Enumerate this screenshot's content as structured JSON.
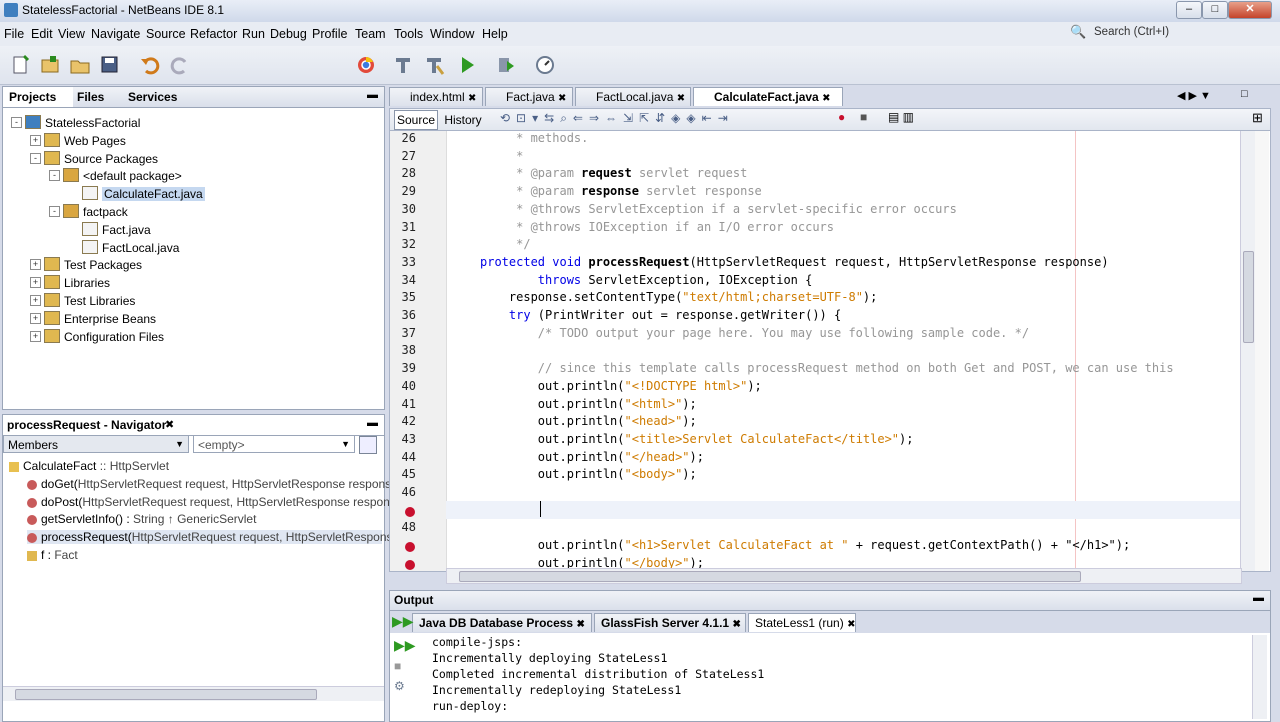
{
  "window": {
    "title": "StatelessFactorial - NetBeans IDE 8.1"
  },
  "menu": [
    "File",
    "Edit",
    "View",
    "Navigate",
    "Source",
    "Refactor",
    "Run",
    "Debug",
    "Profile",
    "Team",
    "Tools",
    "Window",
    "Help"
  ],
  "search": {
    "placeholder": "Search (Ctrl+I)"
  },
  "projects_panel": {
    "tabs": [
      "Projects",
      "Files",
      "Services"
    ],
    "tree": [
      {
        "label": "StatelessFactorial",
        "level": 0,
        "expander": "-",
        "icon": "globe-icon"
      },
      {
        "label": "Web Pages",
        "level": 1,
        "expander": "+",
        "icon": "folder-icon"
      },
      {
        "label": "Source Packages",
        "level": 1,
        "expander": "-",
        "icon": "folder-icon"
      },
      {
        "label": "<default package>",
        "level": 2,
        "expander": "-",
        "icon": "package-icon"
      },
      {
        "label": "CalculateFact.java",
        "level": 3,
        "expander": "",
        "icon": "java-file-icon",
        "selected": true
      },
      {
        "label": "factpack",
        "level": 2,
        "expander": "-",
        "icon": "package-icon"
      },
      {
        "label": "Fact.java",
        "level": 3,
        "expander": "",
        "icon": "java-file-icon"
      },
      {
        "label": "FactLocal.java",
        "level": 3,
        "expander": "",
        "icon": "java-file-icon"
      },
      {
        "label": "Test Packages",
        "level": 1,
        "expander": "+",
        "icon": "folder-icon"
      },
      {
        "label": "Libraries",
        "level": 1,
        "expander": "+",
        "icon": "folder-icon"
      },
      {
        "label": "Test Libraries",
        "level": 1,
        "expander": "+",
        "icon": "folder-icon"
      },
      {
        "label": "Enterprise Beans",
        "level": 1,
        "expander": "+",
        "icon": "folder-icon"
      },
      {
        "label": "Configuration Files",
        "level": 1,
        "expander": "+",
        "icon": "folder-icon"
      }
    ]
  },
  "navigator": {
    "title": "processRequest - Navigator",
    "members_label": "Members",
    "filter_value": "<empty>",
    "items": [
      {
        "name": "CalculateFact",
        "type": " :: HttpServlet"
      },
      {
        "name": "doGet(",
        "type": "HttpServletRequest request, HttpServletResponse response) ↑ H"
      },
      {
        "name": "doPost(",
        "type": "HttpServletRequest request, HttpServletResponse response) ↑"
      },
      {
        "name": "getServletInfo() : ",
        "type": "String ↑ GenericServlet"
      },
      {
        "name": "processRequest(",
        "type": "HttpServletRequest request, HttpServletResponse res"
      },
      {
        "name": "f : ",
        "type": "Fact"
      }
    ]
  },
  "editor": {
    "tabs": [
      {
        "label": "index.html",
        "active": false
      },
      {
        "label": "Fact.java",
        "active": false
      },
      {
        "label": "FactLocal.java",
        "active": false
      },
      {
        "label": "CalculateFact.java",
        "active": true
      }
    ],
    "source_btn": "Source",
    "history_btn": "History",
    "line_numbers": [
      "26",
      "27",
      "28",
      "29",
      "30",
      "31",
      "32",
      "33",
      "34",
      "35",
      "36",
      "37",
      "38",
      "39",
      "40",
      "41",
      "42",
      "43",
      "44",
      "45",
      "46",
      "",
      "48",
      "",
      ""
    ],
    "lines": [
      {
        "a": "     * methods."
      },
      {
        "a": "     *"
      },
      {
        "a": "     * @param ",
        "b": "request",
        "c": " servlet request"
      },
      {
        "a": "     * @param ",
        "b": "response",
        "c": " servlet response"
      },
      {
        "a": "     * @throws ServletException if a servlet-specific error occurs"
      },
      {
        "a": "     * @throws IOException if an I/O error occurs"
      },
      {
        "a": "     */"
      },
      {
        "a": "protected void ",
        "b": "processRequest",
        "c": "(HttpServletRequest request, HttpServletResponse response)"
      },
      {
        "a": "        throws ",
        "b": "ServletException, IOException {"
      },
      {
        "a": "    response.setContentType(",
        "b": "\"text/html;charset=UTF-8\"",
        "c": ");"
      },
      {
        "a": "    try ",
        "b": "(PrintWriter out = response.getWriter()) {"
      },
      {
        "a": "        /* TODO output your page here. You may use following sample code. */"
      },
      {
        "a": ""
      },
      {
        "a": "        // since this template calls processRequest method on both Get and POST, we can use this"
      },
      {
        "a": "        out.println(",
        "b": "\"<!DOCTYPE html>\"",
        "c": ");"
      },
      {
        "a": "        out.println(",
        "b": "\"<html>\"",
        "c": ");"
      },
      {
        "a": "        out.println(",
        "b": "\"<head>\"",
        "c": ");"
      },
      {
        "a": "        out.println(",
        "b": "\"<title>Servlet CalculateFact</title>\"",
        "c": ");"
      },
      {
        "a": "        out.println(",
        "b": "\"</head>\"",
        "c": ");"
      },
      {
        "a": "        out.println(",
        "b": "\"<body>\"",
        "c": ");"
      },
      {
        "a": ""
      },
      {
        "a": ""
      },
      {
        "a": ""
      },
      {
        "a": "        out.println(",
        "b": "\"<h1>Servlet CalculateFact at \"",
        "c": " + request.getContextPath() + \"</h1>\");"
      },
      {
        "a": "        out.println(",
        "b": "\"</body>\"",
        "c": ");"
      }
    ]
  },
  "output": {
    "title": "Output",
    "tabs": [
      "Java DB Database Process",
      "GlassFish Server 4.1.1",
      "StateLess1 (run)"
    ],
    "lines": [
      "compile-jsps:",
      "Incrementally deploying StateLess1",
      "Completed incremental distribution of StateLess1",
      "Incrementally redeploying StateLess1",
      "run-deploy:"
    ]
  },
  "colors": {
    "keyword": "#0000e6",
    "string": "#ce7b00",
    "comment": "#969696",
    "error": "#c8102e"
  }
}
